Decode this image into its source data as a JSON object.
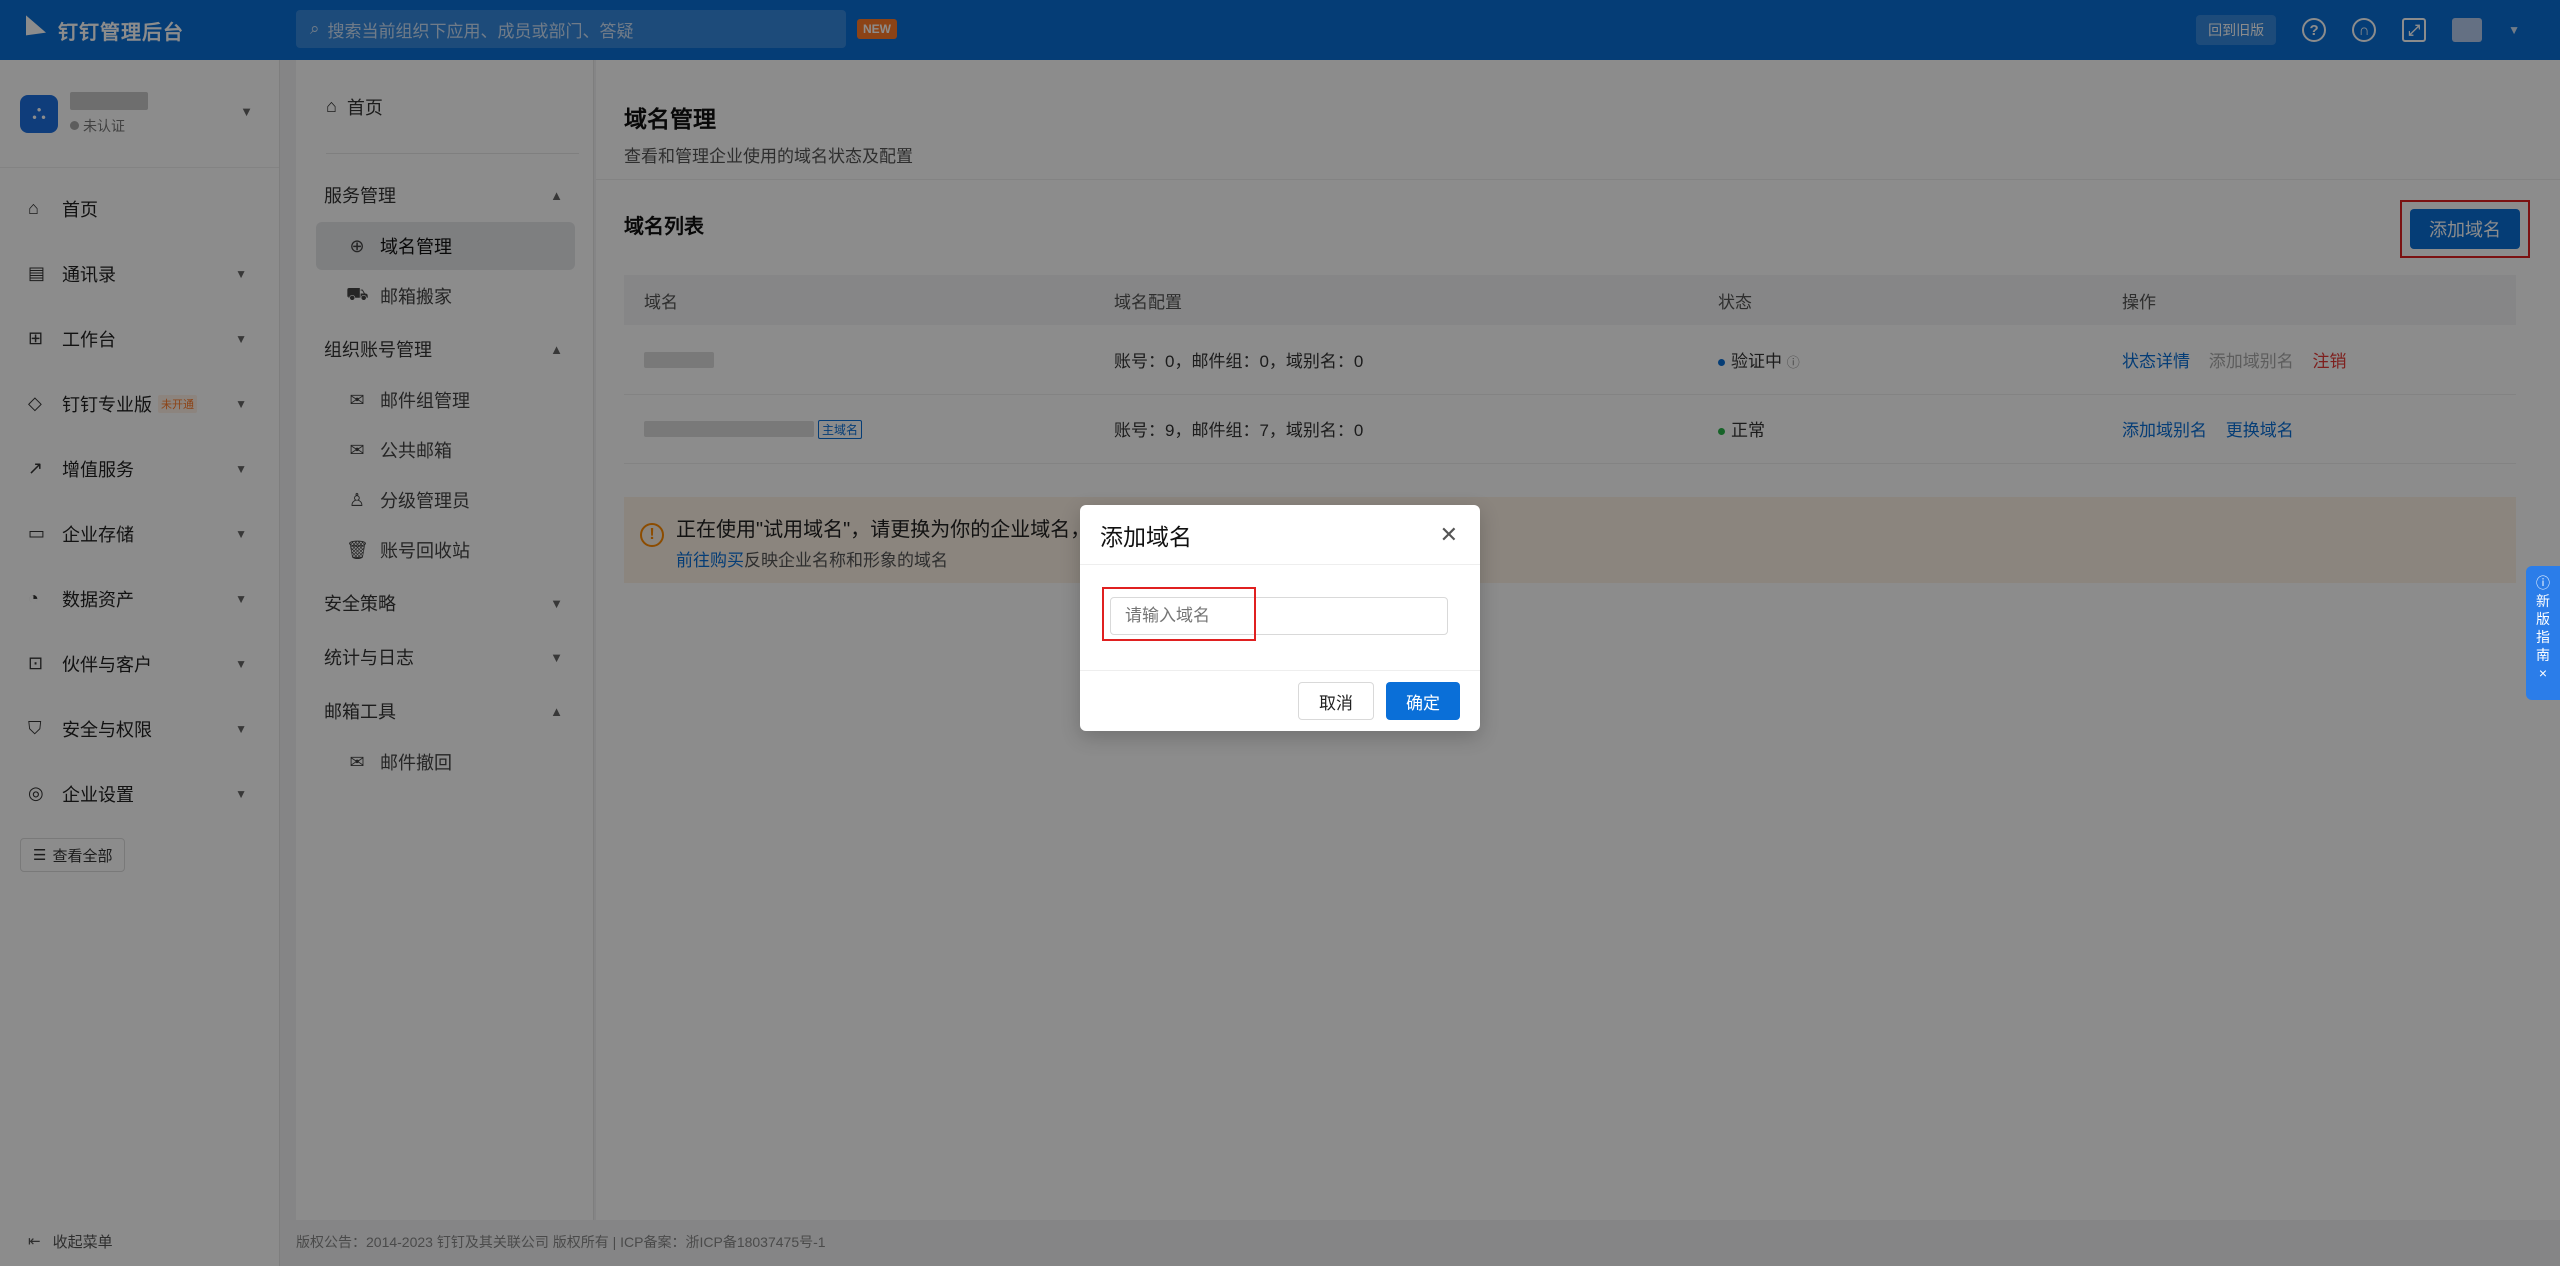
{
  "app": {
    "title": "钉钉管理后台"
  },
  "search": {
    "placeholder": "搜索当前组织下应用、成员或部门、答疑",
    "badge": "NEW"
  },
  "topbar": {
    "old_version_label": "回到旧版"
  },
  "org": {
    "status": "未认证"
  },
  "left_nav": {
    "items": [
      {
        "label": "首页",
        "icon": "home-icon"
      },
      {
        "label": "通讯录",
        "icon": "contacts-icon"
      },
      {
        "label": "工作台",
        "icon": "grid-icon"
      },
      {
        "label": "钉钉专业版",
        "icon": "diamond-icon",
        "badge": "未开通"
      },
      {
        "label": "增值服务",
        "icon": "chart-icon"
      },
      {
        "label": "企业存储",
        "icon": "storage-icon"
      },
      {
        "label": "数据资产",
        "icon": "data-icon"
      },
      {
        "label": "伙伴与客户",
        "icon": "partner-icon"
      },
      {
        "label": "安全与权限",
        "icon": "shield-icon"
      },
      {
        "label": "企业设置",
        "icon": "settings-icon"
      }
    ],
    "see_all": "查看全部",
    "collapse": "收起菜单"
  },
  "sub_nav": {
    "home": "首页",
    "service_group": "服务管理",
    "domain_mgmt": "域名管理",
    "mail_move": "邮箱搬家",
    "org_account_group": "组织账号管理",
    "mail_group_mgmt": "邮件组管理",
    "public_mailbox": "公共邮箱",
    "level_admin": "分级管理员",
    "account_recycle": "账号回收站",
    "security_policy": "安全策略",
    "stats_logs": "统计与日志",
    "mail_tools": "邮箱工具",
    "mail_recall": "邮件撤回"
  },
  "main": {
    "title": "域名管理",
    "subtitle": "查看和管理企业使用的域名状态及配置",
    "list_title": "域名列表",
    "add_button": "添加域名",
    "columns": [
      "域名",
      "域名配置",
      "状态",
      "操作"
    ],
    "rows": [
      {
        "config": "账号：0，邮件组：0，域别名：0",
        "status": "验证中",
        "status_info": "ⓘ",
        "actions": [
          "状态详情",
          "添加域别名",
          "注销"
        ]
      },
      {
        "tag": "主域名",
        "config": "账号：9，邮件组：7，域别名：0",
        "status": "正常",
        "actions": [
          "添加域别名",
          "更换域名"
        ]
      }
    ],
    "notice_title": "正在使用\"试用域名\"，请更换为你的企业域名，",
    "notice_link": "前往购买",
    "notice_rest": "反映企业名称和形象的域名"
  },
  "footer": "版权公告：2014-2023 钉钉及其关联公司 版权所有 | ICP备案：浙ICP备18037475号-1",
  "guide": {
    "chars": [
      "新",
      "版",
      "指",
      "南"
    ]
  },
  "modal": {
    "title": "添加域名",
    "input_placeholder": "请输入域名",
    "cancel": "取消",
    "ok": "确定"
  },
  "colors": {
    "primary": "#0a6fd8",
    "danger": "#e53935",
    "success": "#28b44a",
    "warning": "#ff8a00"
  }
}
